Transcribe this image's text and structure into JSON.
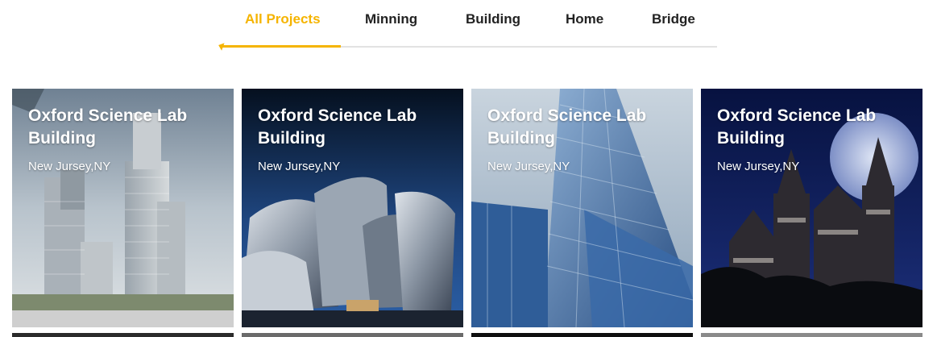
{
  "filter_tabs": [
    {
      "label": "All Projects",
      "active": true
    },
    {
      "label": "Minning",
      "active": false
    },
    {
      "label": "Building",
      "active": false
    },
    {
      "label": "Home",
      "active": false
    },
    {
      "label": "Bridge",
      "active": false
    }
  ],
  "accent_color": "#f5b400",
  "projects": [
    {
      "title": "Oxford Science Lab Building",
      "location": "New Jursey,NY"
    },
    {
      "title": "Oxford Science Lab Building",
      "location": "New Jursey,NY"
    },
    {
      "title": "Oxford Science Lab Building",
      "location": "New Jursey,NY"
    },
    {
      "title": "Oxford Science Lab Building",
      "location": "New Jursey,NY"
    }
  ]
}
